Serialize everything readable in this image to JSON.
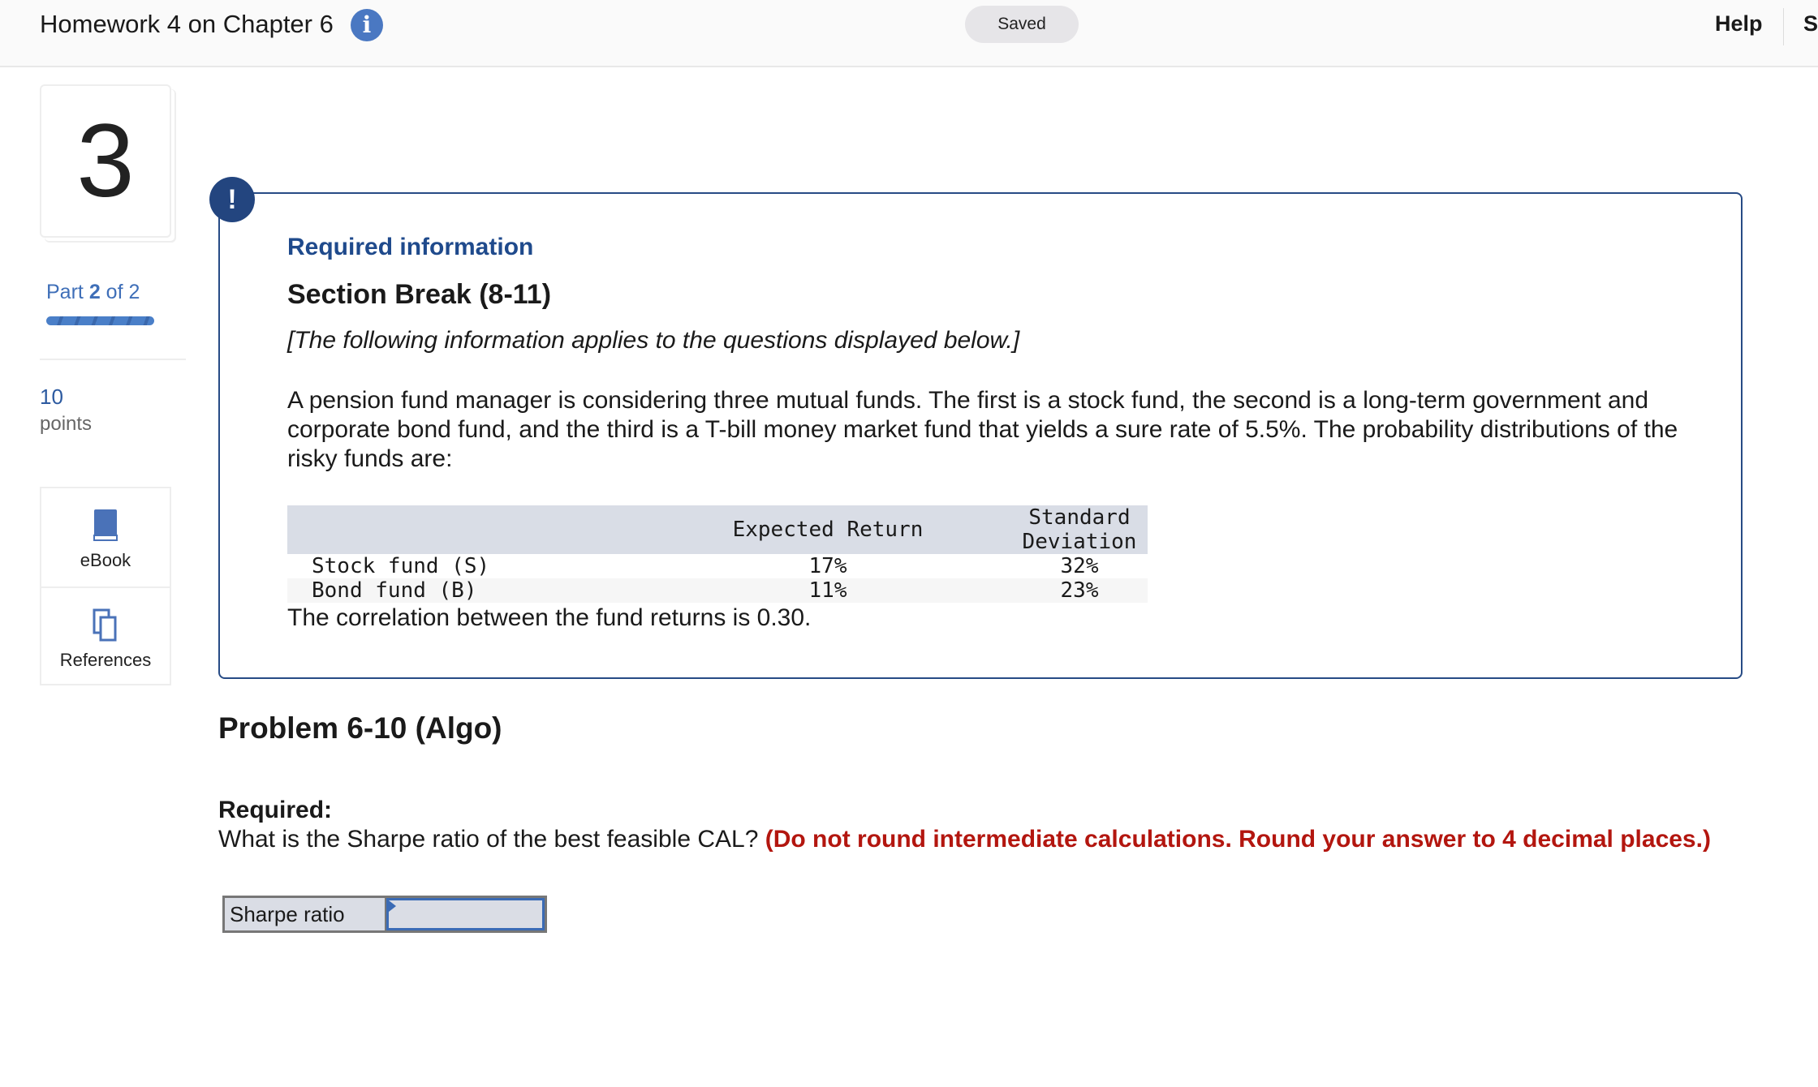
{
  "header": {
    "title": "Homework 4 on Chapter 6",
    "status": "Saved",
    "help": "Help",
    "truncated_item": "S"
  },
  "sidebar": {
    "question_number": "3",
    "part_label": "Part",
    "part_current": "2",
    "part_of": "of 2",
    "progress": 1.0,
    "points_value": "10",
    "points_label": "points",
    "tools": [
      {
        "label": "eBook",
        "icon": "book-icon"
      },
      {
        "label": "References",
        "icon": "copy-icon"
      }
    ]
  },
  "info": {
    "heading": "Required information",
    "section": "Section Break (8-11)",
    "note": "[The following information applies to the questions displayed below.]",
    "paragraph": "A pension fund manager is considering three mutual funds. The first is a stock fund, the second is a long-term government and corporate bond fund, and the third is a T-bill money market fund that yields a sure rate of 5.5%. The probability distributions of the risky funds are:",
    "table": {
      "headers": [
        "",
        "Expected Return",
        "Standard Deviation"
      ],
      "rows": [
        [
          "Stock fund (S)",
          "17%",
          "32%"
        ],
        [
          "Bond fund (B)",
          "11%",
          "23%"
        ]
      ]
    },
    "correlation": "The correlation between the fund returns is 0.30."
  },
  "problem": {
    "title": "Problem 6-10 (Algo)",
    "required_label": "Required:",
    "question": "What is the Sharpe ratio of the best feasible CAL?",
    "instruction": "(Do not round intermediate calculations. Round your answer to 4 decimal places.)",
    "answer_label": "Sharpe ratio",
    "answer_value": ""
  },
  "colors": {
    "accent": "#23457f",
    "link": "#3f6fb8",
    "instruction": "#b3160f"
  }
}
